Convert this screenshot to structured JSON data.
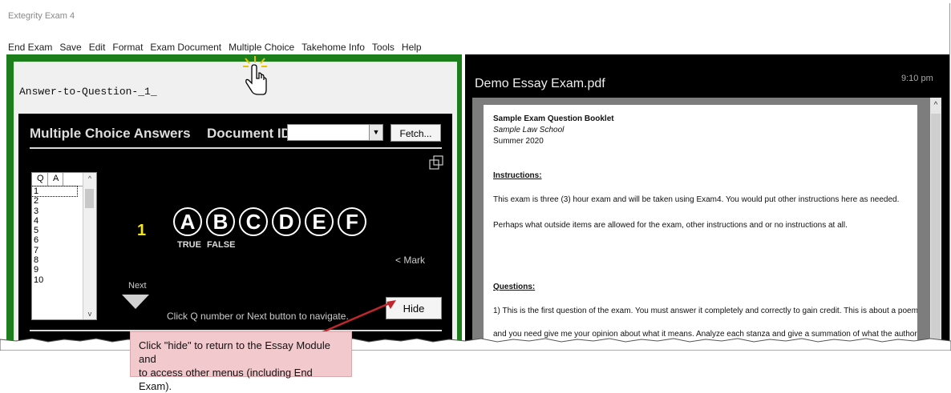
{
  "app": {
    "title": "Extegrity Exam 4"
  },
  "menu": [
    "End Exam",
    "Save",
    "Edit",
    "Format",
    "Exam Document",
    "Multiple Choice",
    "Takehome Info",
    "Tools",
    "Help"
  ],
  "left": {
    "answer_title": "Answer-to-Question-_1_",
    "mc_heading": "Multiple Choice Answers",
    "docid_label": "Document ID",
    "docid_value": "",
    "fetch_label": "Fetch...",
    "list_header_q": "Q",
    "list_header_a": "A",
    "question_rows": [
      "1",
      "2",
      "3",
      "4",
      "5",
      "6",
      "7",
      "8",
      "9",
      "10"
    ],
    "current_question": "1",
    "choices": [
      "A",
      "B",
      "C",
      "D",
      "E",
      "F"
    ],
    "choice_sub_a": "TRUE",
    "choice_sub_b": "FALSE",
    "mark_label": "< Mark",
    "next_label": "Next",
    "nav_hint": "Click Q number or Next button to navigate.",
    "hide_label": "Hide"
  },
  "right": {
    "pdf_title": "Demo Essay Exam.pdf",
    "clock": "9:10 pm",
    "doc": {
      "title": "Sample Exam Question Booklet",
      "school": "Sample Law School",
      "term": "Summer 2020",
      "instructions_heading": "Instructions:",
      "instructions_1": "This exam is three (3) hour exam and will be taken using Exam4. You would put other instructions here as needed.",
      "instructions_2": "Perhaps what outside items are allowed for the exam, other instructions and or no instructions at all.",
      "questions_heading": "Questions:",
      "question_1": "1)  This is the first question of the exam. You must answer it completely and correctly to gain credit. This is about a poem",
      "question_1_cont": "and you need give me your opinion about what it means. Analyze each stanza and give a summation of what the author"
    }
  },
  "callout": {
    "line1": "Click \"hide\" to return to the Essay Module and",
    "line2": "to access other menus (including End Exam)."
  },
  "colors": {
    "frame_green": "#1c7f1c",
    "callout_bg": "#f2c9cc",
    "question_number": "#f3e61e"
  },
  "icons": [
    "hand-cursor-icon",
    "restore-window-icon",
    "next-arrow-icon"
  ]
}
